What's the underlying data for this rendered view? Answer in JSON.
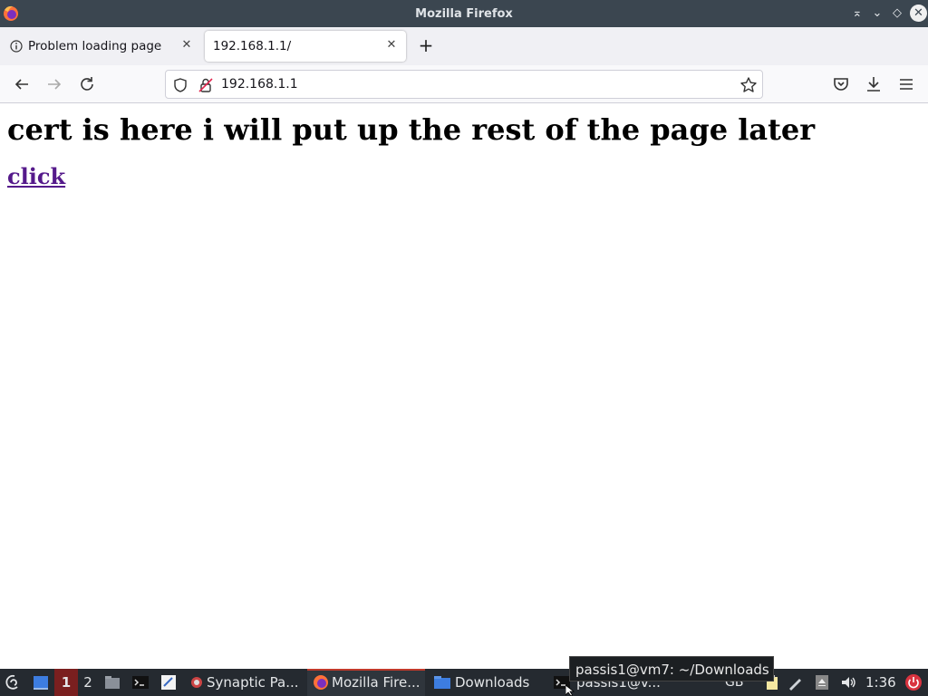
{
  "window": {
    "title": "Mozilla Firefox"
  },
  "tabs": [
    {
      "label": "Problem loading page"
    },
    {
      "label": "192.168.1.1/"
    }
  ],
  "navbar": {
    "url": "192.168.1.1"
  },
  "page": {
    "heading": "cert is here i will put up the rest of the page later",
    "link": "click"
  },
  "tooltip": {
    "text": "passis1@vm7: ~/Downloads"
  },
  "taskbar": {
    "workspace_1": "1",
    "workspace_2": "2",
    "tasks": [
      {
        "label": "Synaptic Pa..."
      },
      {
        "label": "Mozilla Fire..."
      },
      {
        "label": "Downloads"
      },
      {
        "label": "passis1@v..."
      }
    ],
    "clock": "1:36",
    "keyboard": "GB"
  },
  "colors": {
    "link_visited": "#551a8b",
    "titlebar": "#3b4650",
    "taskbar": "#252a30",
    "active_task_indicator": "#c0392b"
  }
}
